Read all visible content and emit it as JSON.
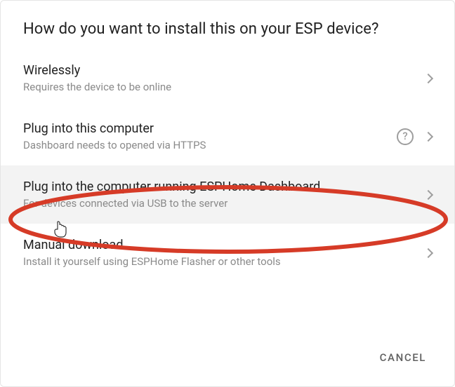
{
  "dialog": {
    "title": "How do you want to install this on your ESP device?",
    "cancel_label": "CANCEL"
  },
  "options": [
    {
      "title": "Wirelessly",
      "subtitle": "Requires the device to be online",
      "help": false,
      "selected": false,
      "name": "option-wirelessly"
    },
    {
      "title": "Plug into this computer",
      "subtitle": "Dashboard needs to opened via HTTPS",
      "help": true,
      "selected": false,
      "name": "option-plug-this-computer"
    },
    {
      "title": "Plug into the computer running ESPHome Dashboard",
      "subtitle": "For devices connected via USB to the server",
      "help": false,
      "selected": true,
      "name": "option-plug-dashboard-computer"
    },
    {
      "title": "Manual download",
      "subtitle": "Install it yourself using ESPHome Flasher or other tools",
      "help": false,
      "selected": false,
      "name": "option-manual-download"
    }
  ],
  "highlight_color": "#d63b27"
}
